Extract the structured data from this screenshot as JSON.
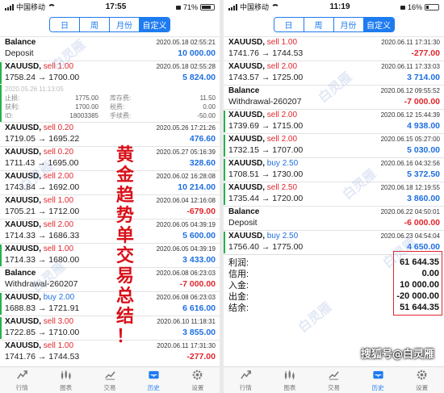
{
  "left": {
    "status": {
      "carrier": "中国移动",
      "time": "17:55",
      "battery": "71%"
    },
    "tabs": [
      "日",
      "周",
      "月份",
      "自定义"
    ],
    "active_tab": 3,
    "rows": [
      {
        "type": "balance",
        "title": "Balance",
        "time": "2020.05.18 02:55:21",
        "desc": "Deposit",
        "amount": "10 000.00",
        "sign": "pos",
        "bar": ""
      },
      {
        "type": "trade",
        "symbol": "XAUUSD,",
        "side": "sell 1.00",
        "dir": "sell",
        "time": "2020.05.18 02:55:28",
        "prices": "1758.24 → 1700.00",
        "profit": "5 824.00",
        "sign": "pos",
        "bar": "#22b34a"
      },
      {
        "type": "trade",
        "symbol": "XAUUSD,",
        "side": "sell 0.20",
        "dir": "sell",
        "time": "2020.05.26 17:21:26",
        "prices": "1719.05 → 1695.22",
        "profit": "476.60",
        "sign": "pos",
        "bar": ""
      },
      {
        "type": "trade",
        "symbol": "XAUUSD,",
        "side": "sell 0.20",
        "dir": "sell",
        "time": "2020.05.27 05:16:39",
        "prices": "1711.43 → 1695.00",
        "profit": "328.60",
        "sign": "pos",
        "bar": ""
      },
      {
        "type": "trade",
        "symbol": "XAUUSD,",
        "side": "sell 2.00",
        "dir": "sell",
        "time": "2020.06.02 16:28:08",
        "prices": "1743.84 → 1692.00",
        "profit": "10 214.00",
        "sign": "pos",
        "bar": ""
      },
      {
        "type": "trade",
        "symbol": "XAUUSD,",
        "side": "sell 1.00",
        "dir": "sell",
        "time": "2020.06.04 12:16:08",
        "prices": "1705.21 → 1712.00",
        "profit": "-679.00",
        "sign": "neg",
        "bar": ""
      },
      {
        "type": "trade",
        "symbol": "XAUUSD,",
        "side": "sell 2.00",
        "dir": "sell",
        "time": "2020.06.05 04:39:19",
        "prices": "1714.33 → 1686.33",
        "profit": "5 600.00",
        "sign": "pos",
        "bar": ""
      },
      {
        "type": "trade",
        "symbol": "XAUUSD,",
        "side": "sell 1.00",
        "dir": "sell",
        "time": "2020.06.05 04:39:19",
        "prices": "1714.33 → 1680.00",
        "profit": "3 433.00",
        "sign": "pos",
        "bar": "#22b34a"
      },
      {
        "type": "balance",
        "title": "Balance",
        "time": "2020.06.08 06:23:03",
        "desc": "Withdrawal-260207",
        "amount": "-7 000.00",
        "sign": "neg",
        "bar": ""
      },
      {
        "type": "trade",
        "symbol": "XAUUSD,",
        "side": "buy 2.00",
        "dir": "buy",
        "time": "2020.06.08 06:23:03",
        "prices": "1688.83 → 1721.91",
        "profit": "6 616.00",
        "sign": "pos",
        "bar": "#22b34a"
      },
      {
        "type": "trade",
        "symbol": "XAUUSD,",
        "side": "sell 3.00",
        "dir": "sell",
        "time": "2020.06.10 11:18:31",
        "prices": "1722.85 → 1710.00",
        "profit": "3 855.00",
        "sign": "pos",
        "bar": "#22b34a"
      },
      {
        "type": "trade",
        "symbol": "XAUUSD,",
        "side": "sell 1.00",
        "dir": "sell",
        "time": "2020.06.11 17:31:30",
        "prices": "1741.76 → 1744.53",
        "profit": "-277.00",
        "sign": "neg",
        "bar": ""
      }
    ],
    "detail": {
      "ghost_time": "2020.05.26 11:13:05",
      "rows": [
        {
          "l1": "止损:",
          "v1": "1775.00",
          "l2": "库存费:",
          "v2": "11.50"
        },
        {
          "l1": "获利:",
          "v1": "1700.00",
          "l2": "税费:",
          "v2": "0.00"
        },
        {
          "l1": "ID:",
          "v1": "18003385",
          "l2": "手续费:",
          "v2": "-50.00"
        }
      ]
    },
    "calligraphy": "黄金趋势单交易总结！"
  },
  "right": {
    "status": {
      "carrier": "中国移动",
      "time": "11:19",
      "battery": "16%"
    },
    "tabs": [
      "日",
      "周",
      "月份",
      "自定义"
    ],
    "active_tab": 3,
    "rows": [
      {
        "type": "trade",
        "symbol": "XAUUSD,",
        "side": "sell 1.00",
        "dir": "sell",
        "time": "2020.06.11 17:31:30",
        "prices": "1741.76 → 1744.53",
        "profit": "-277.00",
        "sign": "neg",
        "bar": ""
      },
      {
        "type": "trade",
        "symbol": "XAUUSD,",
        "side": "sell 2.00",
        "dir": "sell",
        "time": "2020.06.11 17:33:03",
        "prices": "1743.57 → 1725.00",
        "profit": "3 714.00",
        "sign": "pos",
        "bar": ""
      },
      {
        "type": "balance",
        "title": "Balance",
        "time": "2020.06.12 09:55:52",
        "desc": "Withdrawal-260207",
        "amount": "-7 000.00",
        "sign": "neg",
        "bar": ""
      },
      {
        "type": "trade",
        "symbol": "XAUUSD,",
        "side": "sell 2.00",
        "dir": "sell",
        "time": "2020.06.12 15:44:39",
        "prices": "1739.69 → 1715.00",
        "profit": "4 938.00",
        "sign": "pos",
        "bar": "#22b34a"
      },
      {
        "type": "trade",
        "symbol": "XAUUSD,",
        "side": "sell 2.00",
        "dir": "sell",
        "time": "2020.06.15 05:27:00",
        "prices": "1732.15 → 1707.00",
        "profit": "5 030.00",
        "sign": "pos",
        "bar": "#22b34a"
      },
      {
        "type": "trade",
        "symbol": "XAUUSD,",
        "side": "buy 2.50",
        "dir": "buy",
        "time": "2020.06.16 04:32:56",
        "prices": "1708.51 → 1730.00",
        "profit": "5 372.50",
        "sign": "pos",
        "bar": "#22b34a"
      },
      {
        "type": "trade",
        "symbol": "XAUUSD,",
        "side": "sell 2.50",
        "dir": "sell",
        "time": "2020.06.18 12:19:55",
        "prices": "1735.44 → 1720.00",
        "profit": "3 860.00",
        "sign": "pos",
        "bar": "#22b34a"
      },
      {
        "type": "balance",
        "title": "Balance",
        "time": "2020.06.22 04:50:01",
        "desc": "Deposit",
        "amount": "-6 000.00",
        "sign": "neg",
        "bar": ""
      },
      {
        "type": "trade",
        "symbol": "XAUUSD,",
        "side": "buy 2.50",
        "dir": "buy",
        "time": "2020.06.23 04:54:04",
        "prices": "1756.40 → 1775.00",
        "profit": "4 650.00",
        "sign": "pos",
        "bar": "#22b34a"
      }
    ],
    "summary": [
      {
        "label": "利润:",
        "value": "61 644.35"
      },
      {
        "label": "信用:",
        "value": "0.00"
      },
      {
        "label": "入金:",
        "value": "10 000.00"
      },
      {
        "label": "出金:",
        "value": "-20 000.00"
      },
      {
        "label": "结余:",
        "value": "51 644.35"
      }
    ]
  },
  "tabbar": [
    {
      "label": "行情",
      "icon": "quotes-icon"
    },
    {
      "label": "图表",
      "icon": "chart-icon"
    },
    {
      "label": "交易",
      "icon": "trade-icon"
    },
    {
      "label": "历史",
      "icon": "history-icon"
    },
    {
      "label": "设置",
      "icon": "settings-icon"
    }
  ],
  "active_nav": 3,
  "watermark": "白灵雁",
  "credit": "搜狐号@白灵雁",
  "colors": {
    "accent": "#1e7bf0",
    "loss": "#e0262c",
    "gain": "#1e6fe0",
    "bar": "#22b34a"
  }
}
